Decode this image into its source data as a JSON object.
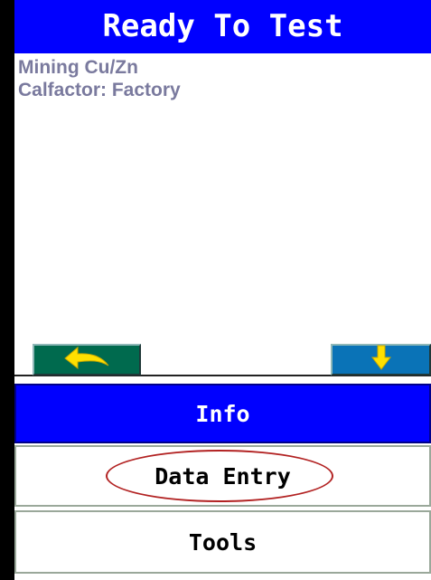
{
  "title": "Ready To Test",
  "status": {
    "mode_line": "Mining Cu/Zn",
    "calfactor_line": "Calfactor: Factory"
  },
  "nav": {
    "back_icon": "back-arrow-icon",
    "down_icon": "down-arrow-icon",
    "back_color": "#006a4e",
    "down_color": "#0a73b7",
    "arrow_color": "#ffe000"
  },
  "menu": {
    "items": [
      {
        "label": "Info",
        "selected": true
      },
      {
        "label": "Data Entry",
        "selected": false,
        "highlighted": true
      },
      {
        "label": "Tools",
        "selected": false
      }
    ]
  },
  "colors": {
    "title_bg": "#0000ff",
    "title_fg": "#ffffff",
    "selected_bg": "#0000ff",
    "highlight_ring": "#b22222",
    "status_text": "#7a7a9e"
  }
}
